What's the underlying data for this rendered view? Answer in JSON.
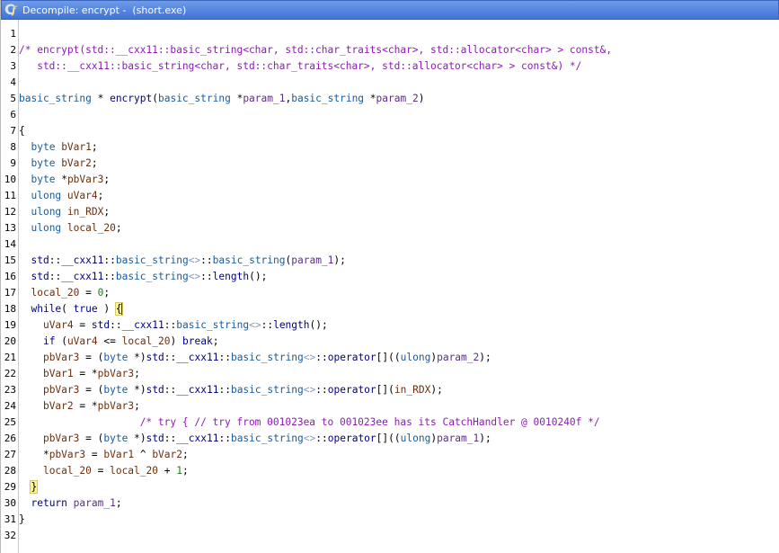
{
  "window": {
    "title": "Decompile: encrypt -  (short.exe)",
    "icon": "decompiler-icon"
  },
  "lines": [
    {
      "n": "1",
      "text": ""
    },
    {
      "n": "2",
      "text": "/* encrypt(std::__cxx11::basic_string<char, std::char_traits<char>, std::allocator<char> > const&,"
    },
    {
      "n": "3",
      "text": "   std::__cxx11::basic_string<char, std::char_traits<char>, std::allocator<char> > const&) */"
    },
    {
      "n": "4",
      "text": ""
    },
    {
      "n": "5",
      "text": "basic_string * encrypt(basic_string *param_1,basic_string *param_2)"
    },
    {
      "n": "6",
      "text": ""
    },
    {
      "n": "7",
      "text": "{"
    },
    {
      "n": "8",
      "text": "  byte bVar1;"
    },
    {
      "n": "9",
      "text": "  byte bVar2;"
    },
    {
      "n": "10",
      "text": "  byte *pbVar3;"
    },
    {
      "n": "11",
      "text": "  ulong uVar4;"
    },
    {
      "n": "12",
      "text": "  ulong in_RDX;"
    },
    {
      "n": "13",
      "text": "  ulong local_20;"
    },
    {
      "n": "14",
      "text": ""
    },
    {
      "n": "15",
      "text": "  std::__cxx11::basic_string<>::basic_string(param_1);"
    },
    {
      "n": "16",
      "text": "  std::__cxx11::basic_string<>::length();"
    },
    {
      "n": "17",
      "text": "  local_20 = 0;"
    },
    {
      "n": "18",
      "text": "  while( true ) {"
    },
    {
      "n": "19",
      "text": "    uVar4 = std::__cxx11::basic_string<>::length();"
    },
    {
      "n": "20",
      "text": "    if (uVar4 <= local_20) break;"
    },
    {
      "n": "21",
      "text": "    pbVar3 = (byte *)std::__cxx11::basic_string<>::operator[]((ulong)param_2);"
    },
    {
      "n": "22",
      "text": "    bVar1 = *pbVar3;"
    },
    {
      "n": "23",
      "text": "    pbVar3 = (byte *)std::__cxx11::basic_string<>::operator[](in_RDX);"
    },
    {
      "n": "24",
      "text": "    bVar2 = *pbVar3;"
    },
    {
      "n": "25",
      "text": "                    /* try { // try from 001023ea to 001023ee has its CatchHandler @ 0010240f */"
    },
    {
      "n": "26",
      "text": "    pbVar3 = (byte *)std::__cxx11::basic_string<>::operator[]((ulong)param_1);"
    },
    {
      "n": "27",
      "text": "    *pbVar3 = bVar1 ^ bVar2;"
    },
    {
      "n": "28",
      "text": "    local_20 = local_20 + 1;"
    },
    {
      "n": "29",
      "text": "  }"
    },
    {
      "n": "30",
      "text": "  return param_1;"
    },
    {
      "n": "31",
      "text": "}"
    },
    {
      "n": "32",
      "text": ""
    }
  ]
}
